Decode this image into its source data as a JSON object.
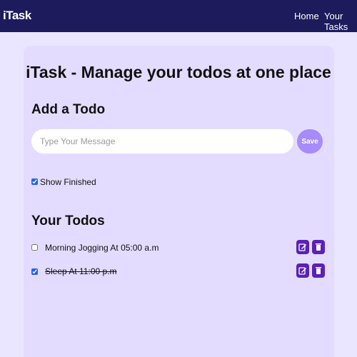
{
  "navbar": {
    "brand": "iTask",
    "links": [
      "Home",
      "Your Tasks"
    ]
  },
  "main": {
    "title": "iTask - Manage your todos at one place",
    "add_section": {
      "heading": "Add a Todo",
      "input_placeholder": "Type Your Message",
      "input_value": "",
      "save_label": "Save"
    },
    "show_finished": {
      "label": "Show Finished",
      "checked": true
    },
    "todos_section": {
      "heading": "Your Todos",
      "todos": [
        {
          "text": "Morning Jogging At 05:00 a.m",
          "completed": false
        },
        {
          "text": "Sleep At 11:00 p.m",
          "completed": true
        }
      ]
    }
  },
  "colors": {
    "navbar": "#1e1b5c",
    "page_background": "#ebe6ff",
    "card_background": "#e3dcff",
    "save_button": "#a78bfa",
    "action_button": "#5b21b6"
  },
  "icons": {
    "edit": "edit-icon",
    "delete": "delete-icon"
  }
}
